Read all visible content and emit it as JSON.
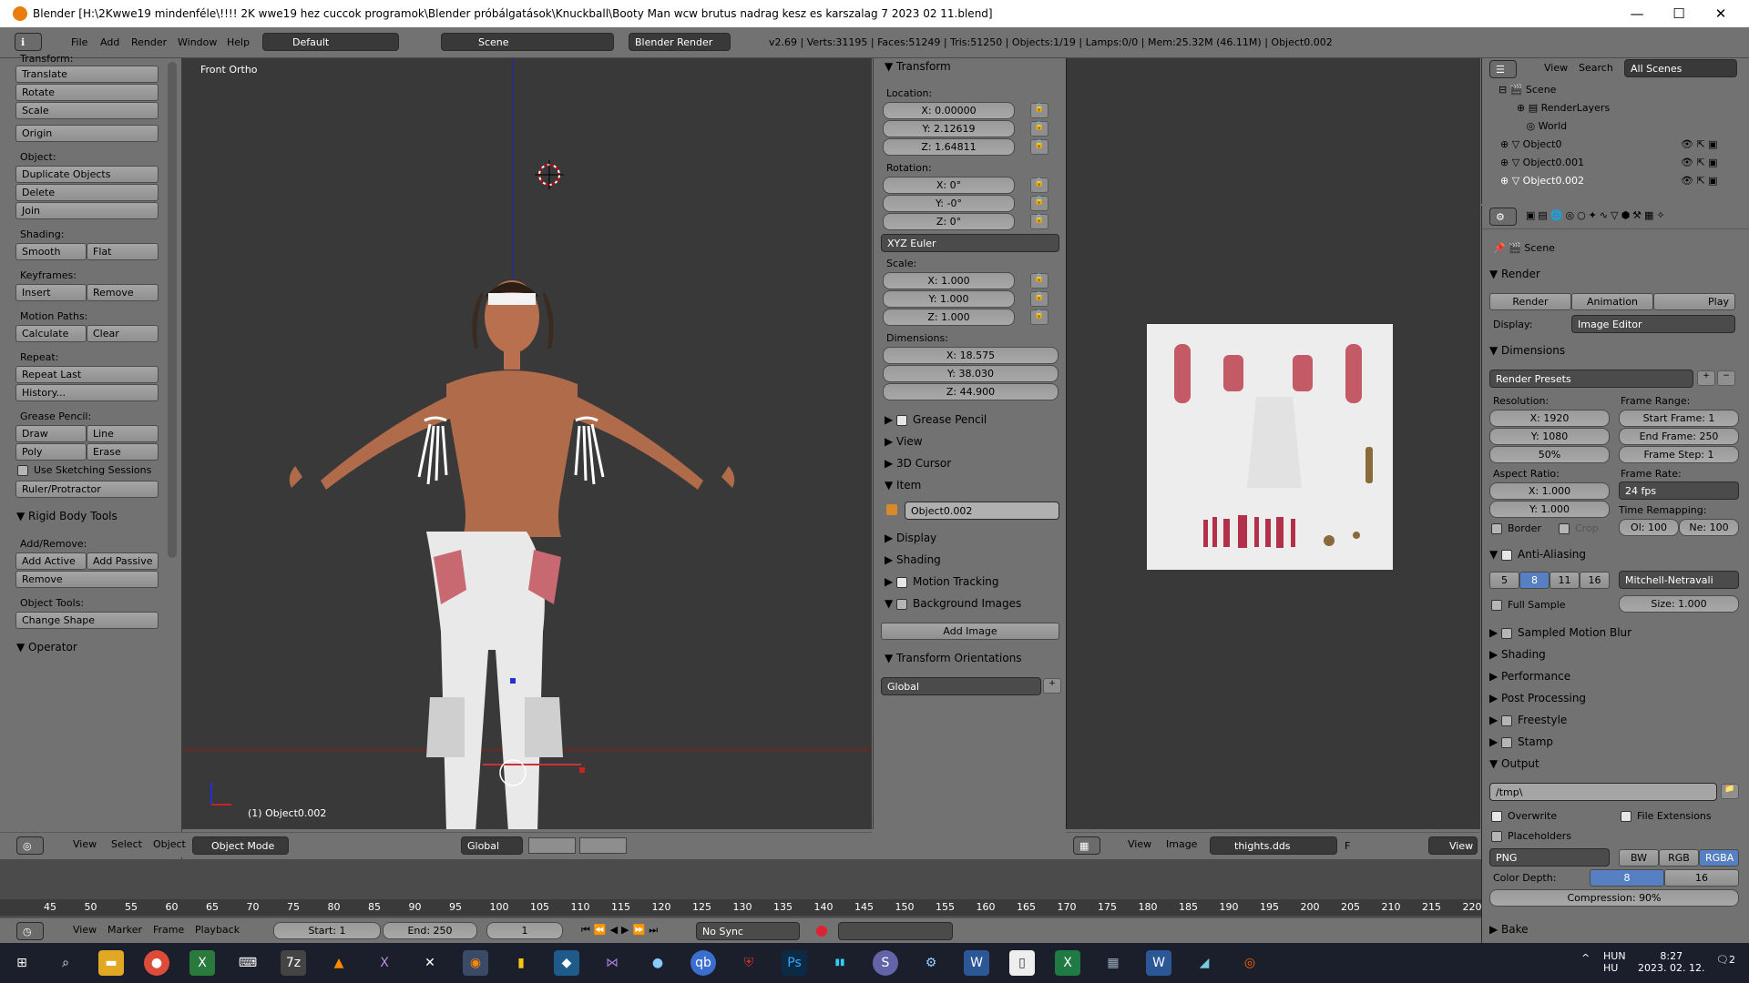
{
  "window": {
    "title": "Blender [H:\\2Kwwe19 mindenféle\\!!!! 2K wwe19 hez cuccok programok\\Blender próbálgatások\\Knuckball\\Booty Man wcw brutus nadrag kesz es karszalag 7 2023 02 11.blend]",
    "minimize": "—",
    "maximize": "☐",
    "close": "✕"
  },
  "infobar": {
    "menus": [
      "File",
      "Add",
      "Render",
      "Window",
      "Help"
    ],
    "screen": "Default",
    "scene": "Scene",
    "engine": "Blender Render",
    "stats": "v2.69 | Verts:31195 | Faces:51249 | Tris:51250 | Objects:1/19 | Lamps:0/0 | Mem:25.32M (46.11M) | Object0.002"
  },
  "toolshelf": {
    "transform_header": "Transform:",
    "transform": [
      "Translate",
      "Rotate",
      "Scale"
    ],
    "origin": "Origin",
    "object_label": "Object:",
    "object": [
      "Duplicate Objects",
      "Delete",
      "Join"
    ],
    "shading_label": "Shading:",
    "smooth": "Smooth",
    "flat": "Flat",
    "keyframes_label": "Keyframes:",
    "insert": "Insert",
    "remove": "Remove",
    "motion_label": "Motion Paths:",
    "calculate": "Calculate",
    "clear": "Clear",
    "repeat_label": "Repeat:",
    "repeat_last": "Repeat Last",
    "history": "History...",
    "grease_label": "Grease Pencil:",
    "draw": "Draw",
    "line": "Line",
    "poly": "Poly",
    "erase": "Erase",
    "sketching": "Use Sketching Sessions",
    "ruler": "Ruler/Protractor",
    "rigid_header": "Rigid Body Tools",
    "addremove_label": "Add/Remove:",
    "add_active": "Add Active",
    "add_passive": "Add Passive",
    "rb_remove": "Remove",
    "objtools_label": "Object Tools:",
    "change_shape": "Change Shape",
    "operator": "Operator"
  },
  "viewport": {
    "view_name": "Front Ortho",
    "object_label": "(1) Object0.002",
    "header": {
      "menus": [
        "View",
        "Select",
        "Object"
      ],
      "mode": "Object Mode",
      "orientation": "Global"
    }
  },
  "npanel": {
    "transform": "Transform",
    "location": "Location:",
    "loc": [
      "X: 0.00000",
      "Y: 2.12619",
      "Z: 1.64811"
    ],
    "rotation": "Rotation:",
    "rot": [
      "X: 0°",
      "Y: -0°",
      "Z: 0°"
    ],
    "rot_mode": "XYZ Euler",
    "scale": "Scale:",
    "scl": [
      "X: 1.000",
      "Y: 1.000",
      "Z: 1.000"
    ],
    "dimensions": "Dimensions:",
    "dim": [
      "X: 18.575",
      "Y: 38.030",
      "Z: 44.900"
    ],
    "grease": "Grease Pencil",
    "view": "View",
    "cursor": "3D Cursor",
    "item": "Item",
    "item_name": "Object0.002",
    "display": "Display",
    "shading": "Shading",
    "motion": "Motion Tracking",
    "bg_images": "Background Images",
    "add_image": "Add Image",
    "orient": "Transform Orientations",
    "orient_val": "Global"
  },
  "imgeditor": {
    "menus": [
      "View",
      "Image"
    ],
    "image_name": "thights.dds",
    "fake": "F",
    "view_btn": "View"
  },
  "outliner": {
    "menus": [
      "View",
      "Search"
    ],
    "filter": "All Scenes",
    "items": [
      "Scene",
      "RenderLayers",
      "World",
      "Object0",
      "Object0.001",
      "Object0.002"
    ]
  },
  "props": {
    "scene": "Scene",
    "render": "Render",
    "render_btn": "Render",
    "anim_btn": "Animation",
    "play_btn": "Play",
    "display_label": "Display:",
    "display_val": "Image Editor",
    "dimensions": "Dimensions",
    "presets": "Render Presets",
    "resolution": "Resolution:",
    "res_x": "X: 1920",
    "res_y": "Y: 1080",
    "res_pct": "50%",
    "frame_range": "Frame Range:",
    "start": "Start Frame: 1",
    "end": "End Frame: 250",
    "step": "Frame Step: 1",
    "aspect": "Aspect Ratio:",
    "asp_x": "X: 1.000",
    "asp_y": "Y: 1.000",
    "frame_rate": "Frame Rate:",
    "fps": "24 fps",
    "border": "Border",
    "crop": "Crop",
    "remap": "Time Remapping:",
    "old": "Ol: 100",
    "new": "Ne: 100",
    "aa": "Anti-Aliasing",
    "aa_vals": [
      "5",
      "8",
      "11",
      "16"
    ],
    "aa_filter": "Mitchell-Netravali",
    "full_sample": "Full Sample",
    "size": "Size: 1.000",
    "smb": "Sampled Motion Blur",
    "shading": "Shading",
    "performance": "Performance",
    "post": "Post Processing",
    "freestyle": "Freestyle",
    "stamp": "Stamp",
    "output": "Output",
    "path": "/tmp\\",
    "overwrite": "Overwrite",
    "file_ext": "File Extensions",
    "placeholders": "Placeholders",
    "format": "PNG",
    "bw": "BW",
    "rgb": "RGB",
    "rgba": "RGBA",
    "color_depth": "Color Depth:",
    "cd8": "8",
    "cd16": "16",
    "compression": "Compression: 90%",
    "bake": "Bake"
  },
  "timeline": {
    "ticks": [
      "45",
      "50",
      "55",
      "60",
      "65",
      "70",
      "75",
      "80",
      "85",
      "90",
      "95",
      "100",
      "105",
      "110",
      "115",
      "120",
      "125",
      "130",
      "135",
      "140",
      "145",
      "150",
      "155",
      "160",
      "165",
      "170",
      "175",
      "180",
      "185",
      "190",
      "195",
      "200",
      "205",
      "210",
      "215",
      "220"
    ],
    "menus": [
      "View",
      "Marker",
      "Frame",
      "Playback"
    ],
    "start": "Start: 1",
    "end": "End: 250",
    "current": "1",
    "sync": "No Sync"
  },
  "taskbar": {
    "lang": "HUN",
    "lang2": "HU",
    "time": "8:27",
    "date": "2023. 02. 12.",
    "notif": "2"
  }
}
